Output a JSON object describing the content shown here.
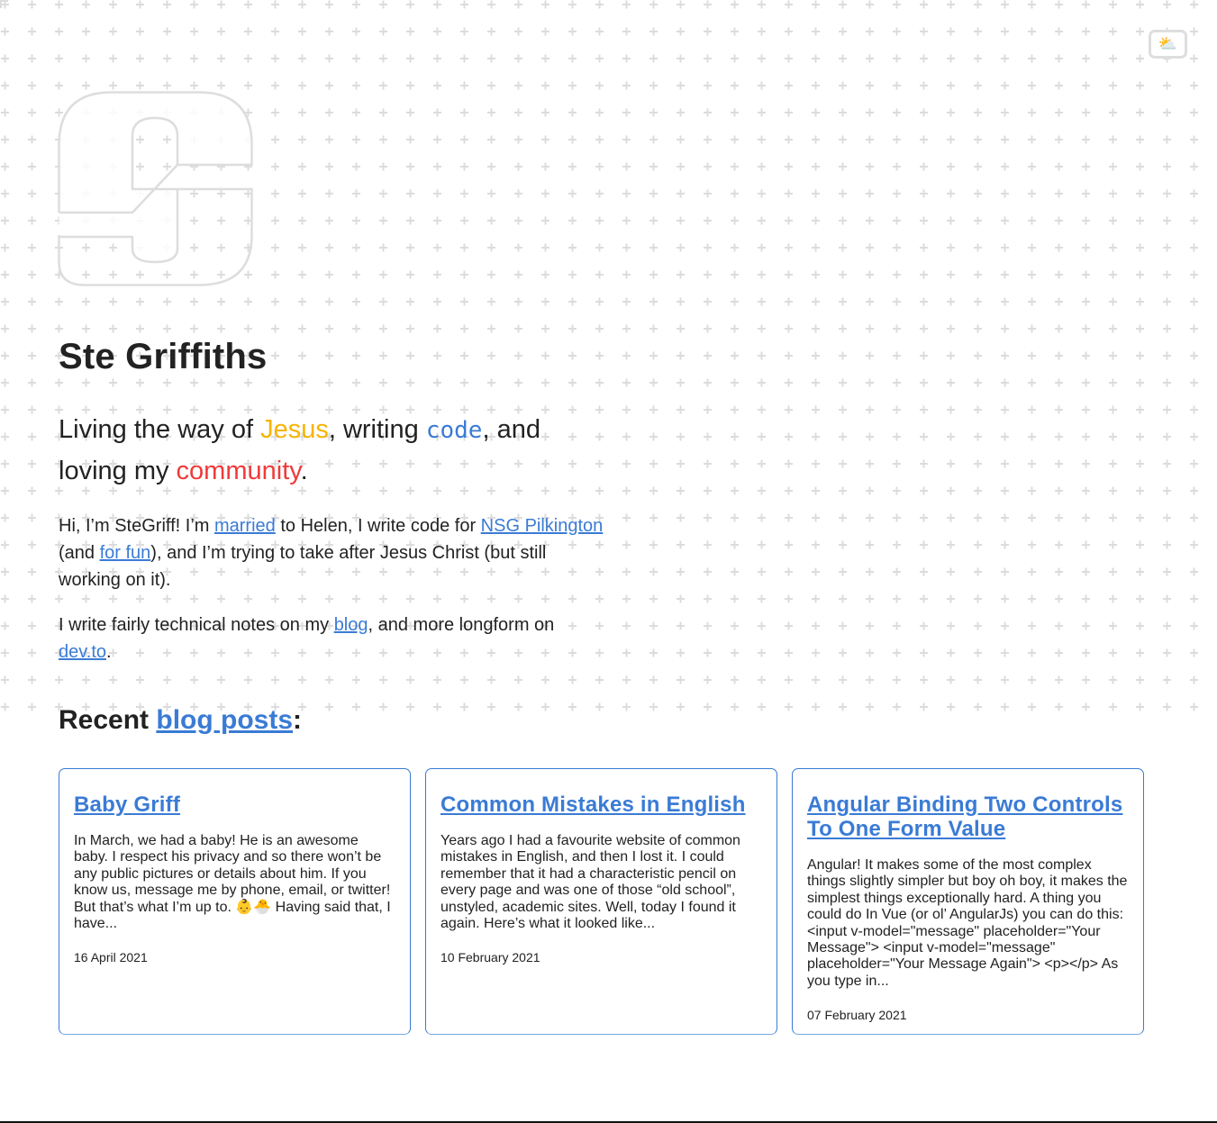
{
  "theme_toggle": {
    "icon": "sun-behind-cloud-icon",
    "glyph": "⛅"
  },
  "logo": {
    "icon": "sg-monogram-logo"
  },
  "header": {
    "title": "Ste Griffiths"
  },
  "tagline": {
    "part1": "Living the way of ",
    "jesus": "Jesus",
    "part2": ", writing ",
    "code": "code",
    "part3": ", and loving my ",
    "community": "community",
    "part4": "."
  },
  "intro": {
    "p1": {
      "t1": "Hi, I’m SteGriff! I’m ",
      "link_married": "married",
      "t2": " to Helen, I write code for ",
      "link_employer": "NSG Pilkington",
      "t3": " (and ",
      "link_fun": "for fun",
      "t4": "), and I’m trying to take after Jesus Christ (but still working on it)."
    },
    "p2": {
      "t1": "I write fairly technical notes on my ",
      "link_blog": "blog",
      "t2": ", and more longform on ",
      "link_devto": "dev.to",
      "t3": "."
    }
  },
  "recent": {
    "prefix": "Recent ",
    "link": "blog posts",
    "suffix": ":"
  },
  "posts": [
    {
      "title": "Baby Griff",
      "excerpt": "In March, we had a baby! He is an awesome baby. I respect his privacy and so there won’t be any public pictures or details about him. If you know us, message me by phone, email, or twitter! But that’s what I’m up to. 👶🐣 Having said that, I have...",
      "date": "16 April 2021"
    },
    {
      "title": "Common Mistakes in English",
      "excerpt": "Years ago I had a favourite website of common mistakes in English, and then I lost it. I could remember that it had a characteristic pencil on every page and was one of those “old school”, unstyled, academic sites. Well, today I found it again. Here’s what it looked like...",
      "date": "10 February 2021"
    },
    {
      "title": "Angular Binding Two Controls To One Form Value",
      "excerpt": "Angular! It makes some of the most complex things slightly simpler but boy oh boy, it makes the simplest things exceptionally hard. A thing you could do In Vue (or ol’ AngularJs) you can do this: <input v-model=\"message\" placeholder=\"Your Message\"> <input v-model=\"message\" placeholder=\"Your Message Again\"> <p></p> As you type in...",
      "date": "07 February 2021"
    }
  ],
  "colors": {
    "link": "#3a7bd5",
    "jesus": "#f6b400",
    "community": "#f03a3a",
    "text": "#222222",
    "grid": "#dcdcdc"
  }
}
